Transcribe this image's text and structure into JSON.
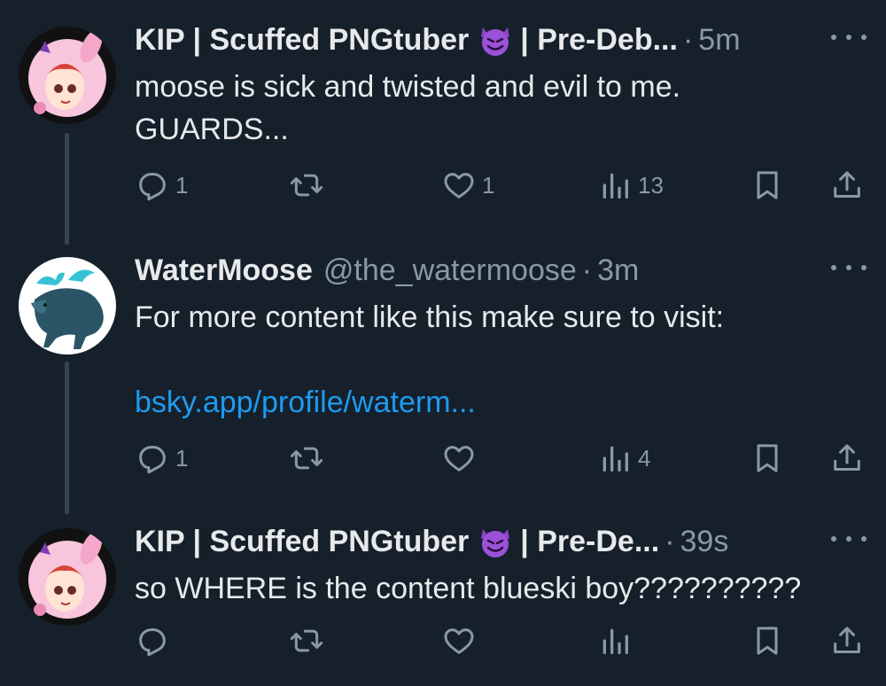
{
  "tweets": [
    {
      "name": "KIP | Scuffed PNGtuber",
      "name_suffix": "| Pre-Deb...",
      "handle": "",
      "time": "5m",
      "body": "moose is sick and twisted and evil to me.\nGUARDS...",
      "link": "",
      "replies": "1",
      "retweets": "",
      "likes": "1",
      "views": "13"
    },
    {
      "name": "WaterMoose",
      "name_suffix": "",
      "handle": "@the_watermoose",
      "time": "3m",
      "body": "For more content like this make sure to visit:",
      "link": "bsky.app/profile/waterm...",
      "replies": "1",
      "retweets": "",
      "likes": "",
      "views": "4"
    },
    {
      "name": "KIP | Scuffed PNGtuber",
      "name_suffix": "| Pre-De...",
      "handle": "",
      "time": "39s",
      "body": "so WHERE is the content blueski boy??????????",
      "link": "",
      "replies": "",
      "retweets": "",
      "likes": "",
      "views": ""
    }
  ],
  "icons": {
    "reply": "reply-icon",
    "retweet": "retweet-icon",
    "like": "heart-icon",
    "views": "views-icon",
    "bookmark": "bookmark-icon",
    "share": "share-icon",
    "more": "more-icon",
    "emoji": "smiling-devil-emoji"
  },
  "colors": {
    "background": "#15202b",
    "text": "#e7e9ea",
    "muted": "#8b98a5",
    "link": "#1d9bf0",
    "thread_line": "#38444d"
  }
}
